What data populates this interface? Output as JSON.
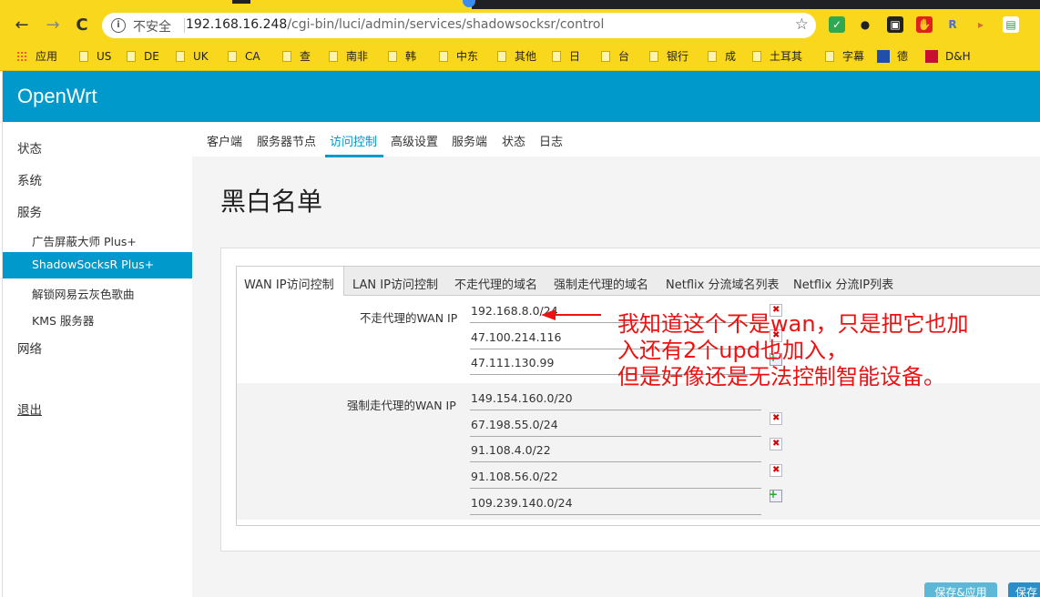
{
  "browser": {
    "nav": {
      "back": "←",
      "forward": "→",
      "reload": "C"
    },
    "security_label": "不安全",
    "url_host": "192.168.16.248",
    "url_path": "/cgi-bin/luci/admin/services/shadowsocksr/control",
    "extensions": [
      {
        "name": "shield-extension-icon",
        "glyph": "✓",
        "bg": "#2fa84f",
        "fg": "#fff"
      },
      {
        "name": "mask-extension-icon",
        "glyph": "●",
        "bg": "#f9d71c",
        "fg": "#222"
      },
      {
        "name": "face-extension-icon",
        "glyph": "▣",
        "bg": "#222",
        "fg": "#fff"
      },
      {
        "name": "stop-extension-icon",
        "glyph": "✋",
        "bg": "#e01f1f",
        "fg": "#fff"
      },
      {
        "name": "r-extension-icon",
        "glyph": "R",
        "bg": "#f9d71c",
        "fg": "#4a6ee0"
      },
      {
        "name": "flag-extension-icon",
        "glyph": "▸",
        "bg": "#f9d71c",
        "fg": "#d07030"
      },
      {
        "name": "sheet-extension-icon",
        "glyph": "▤",
        "bg": "#ffffff",
        "fg": "#2a9d3a"
      }
    ]
  },
  "bookmarks": [
    {
      "label": "应用",
      "kind": "apps"
    },
    {
      "label": "US",
      "kind": "folder"
    },
    {
      "label": "DE",
      "kind": "folder"
    },
    {
      "label": "UK",
      "kind": "folder"
    },
    {
      "label": "CA",
      "kind": "folder"
    },
    {
      "label": "查",
      "kind": "folder"
    },
    {
      "label": "南非",
      "kind": "folder"
    },
    {
      "label": "韩",
      "kind": "folder"
    },
    {
      "label": "中东",
      "kind": "folder"
    },
    {
      "label": "其他",
      "kind": "folder"
    },
    {
      "label": "日",
      "kind": "folder"
    },
    {
      "label": "台",
      "kind": "folder"
    },
    {
      "label": "银行",
      "kind": "folder"
    },
    {
      "label": "成",
      "kind": "folder"
    },
    {
      "label": "土耳其",
      "kind": "folder"
    },
    {
      "label": "字幕",
      "kind": "folder"
    },
    {
      "label": "德",
      "kind": "blue"
    },
    {
      "label": "D&H",
      "kind": "red"
    }
  ],
  "brand": "OpenWrt",
  "sidebar": {
    "items": [
      {
        "label": "状态"
      },
      {
        "label": "系统"
      },
      {
        "label": "服务"
      },
      {
        "label": "广告屏蔽大师 Plus+"
      },
      {
        "label": "ShadowSocksR Plus+"
      },
      {
        "label": "解锁网易云灰色歌曲"
      },
      {
        "label": "KMS 服务器"
      },
      {
        "label": "网络"
      },
      {
        "label": "退出"
      }
    ]
  },
  "subtabs": [
    "客户端",
    "服务器节点",
    "访问控制",
    "高级设置",
    "服务端",
    "状态",
    "日志"
  ],
  "page_title": "黑白名单",
  "content_tabs": [
    "WAN IP访问控制",
    "LAN IP访问控制",
    "不走代理的域名",
    "强制走代理的域名",
    "Netflix 分流域名列表",
    "Netflix 分流IP列表"
  ],
  "wan_bypass": {
    "label": "不走代理的WAN IP",
    "values": [
      "192.168.8.0/24",
      "47.100.214.116",
      "47.111.130.99"
    ]
  },
  "wan_force": {
    "label": "强制走代理的WAN IP",
    "values": [
      "149.154.160.0/20",
      "67.198.55.0/24",
      "91.108.4.0/22",
      "91.108.56.0/22",
      "109.239.140.0/24"
    ]
  },
  "annotation": {
    "lines": [
      "我知道这个不是wan，只是把它也加",
      "入还有2个upd也加入，",
      "但是好像还是无法控制智能设备。"
    ],
    "color": "#ee1111"
  },
  "buttons": {
    "save_apply": "保存&应用",
    "save": "保存"
  },
  "colors": {
    "accent": "#0099cc",
    "browser_bar": "#f9d71c"
  }
}
